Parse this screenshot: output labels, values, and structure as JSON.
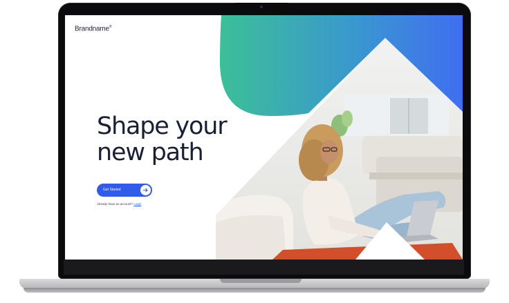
{
  "brand": {
    "name": "Brandname",
    "mark": "®"
  },
  "hero": {
    "headline_line1": "Shape your",
    "headline_line2": "new path"
  },
  "cta": {
    "label": "Get Started",
    "arrow_icon": "arrow-right-icon"
  },
  "login": {
    "prompt": "Already have an account?",
    "link_label": "Login"
  },
  "colors": {
    "accent": "#2f5ce8",
    "gradient_start": "#3dbd9a",
    "gradient_end": "#3f6ef0",
    "headline": "#1a2033"
  }
}
